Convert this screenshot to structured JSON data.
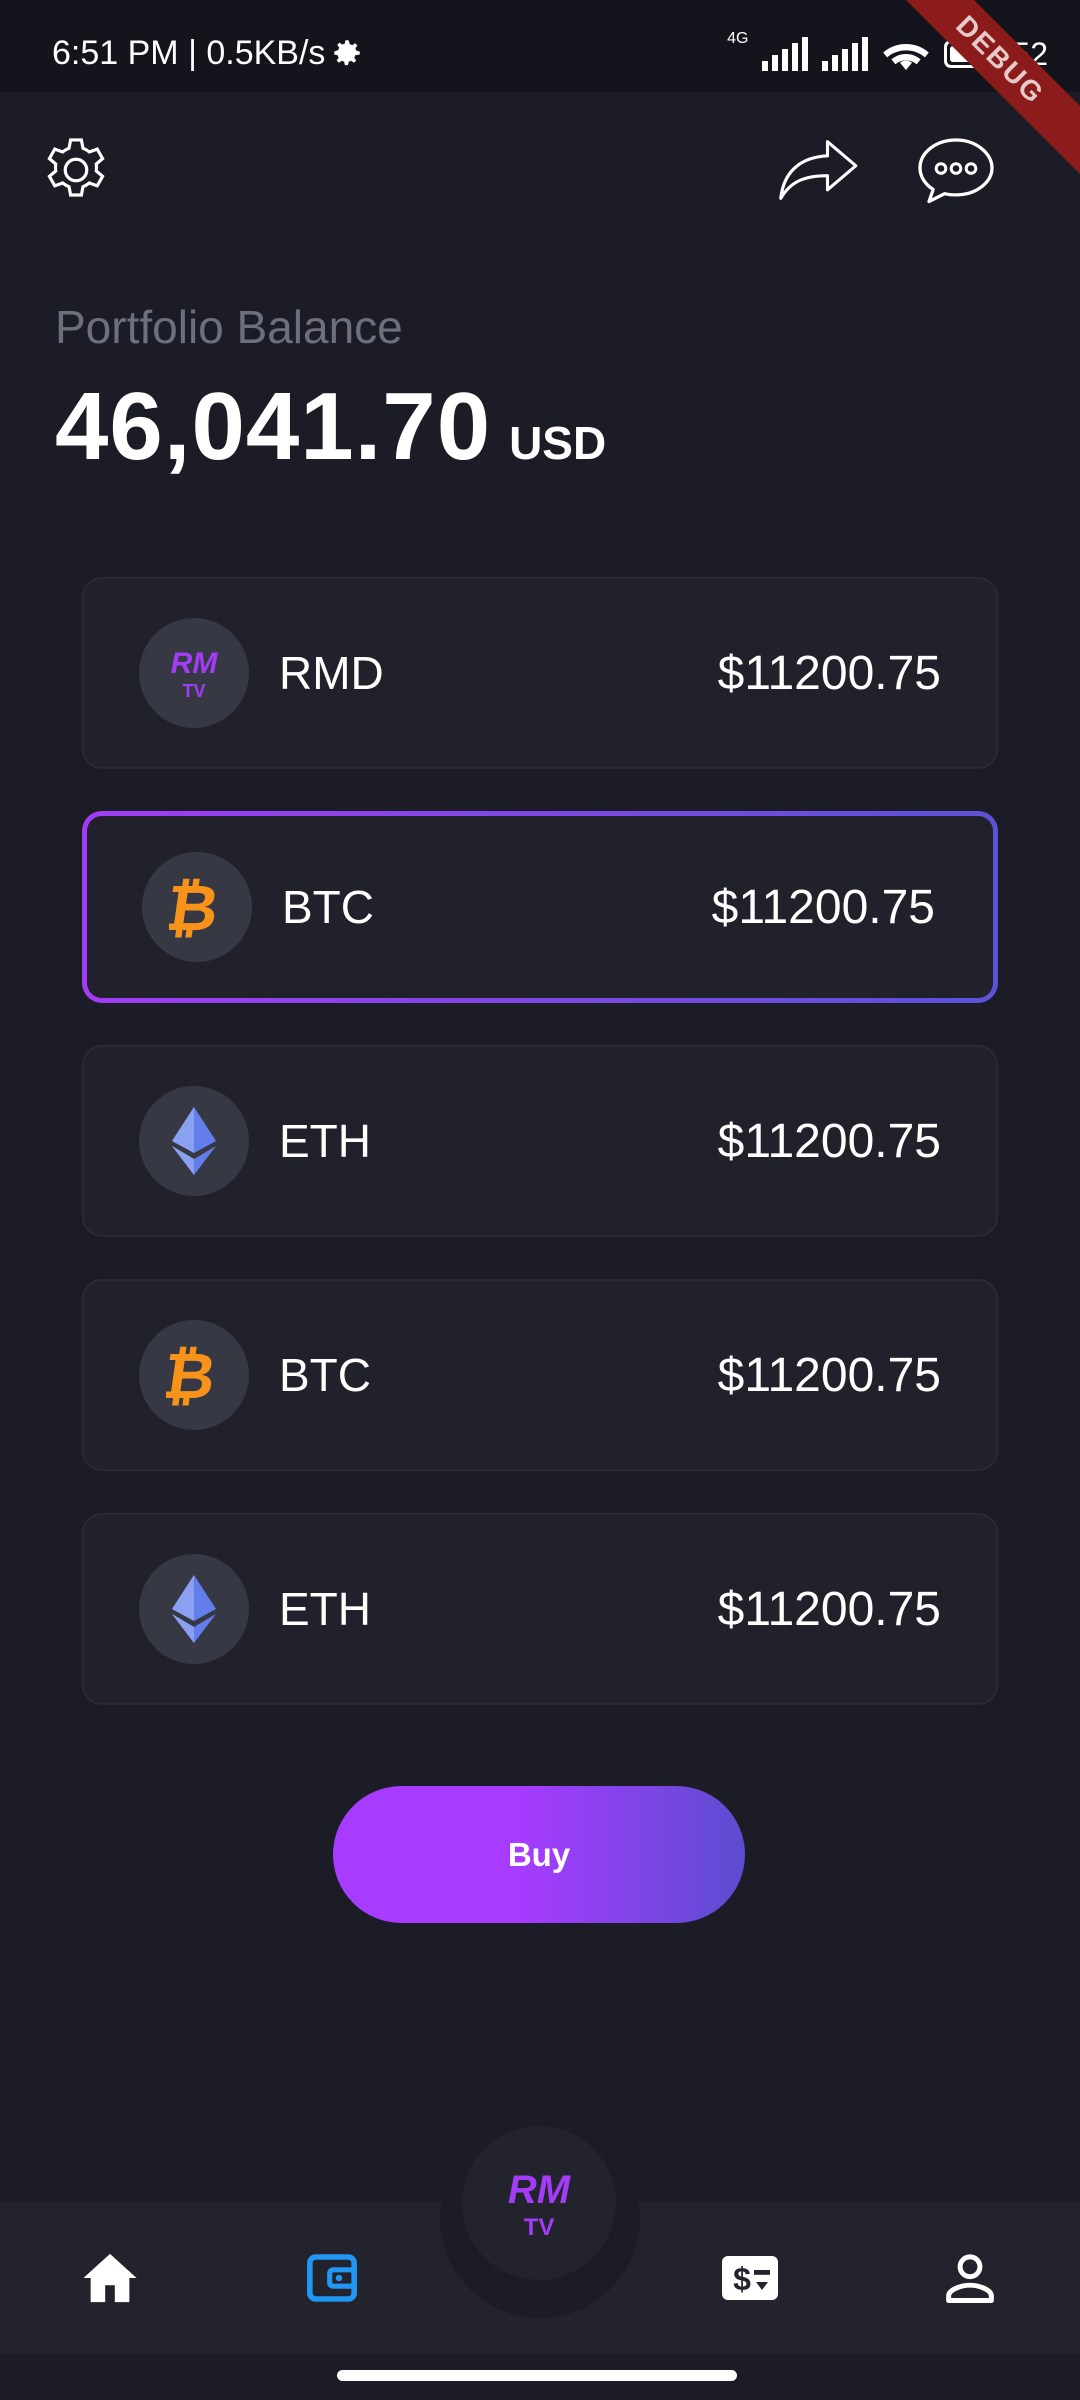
{
  "status_bar": {
    "time": "6:51 PM | 0.5KB/s",
    "network_label": "4G",
    "battery": "52",
    "debug_label": "DEBUG"
  },
  "header": {
    "icons": [
      "settings-icon",
      "share-icon",
      "chat-icon"
    ]
  },
  "portfolio": {
    "label": "Portfolio Balance",
    "amount": "46,041.70",
    "currency": "USD"
  },
  "assets": [
    {
      "symbol": "RMD",
      "value": "$11200.75",
      "icon": "rmtv-logo-icon",
      "selected": false
    },
    {
      "symbol": "BTC",
      "value": "$11200.75",
      "icon": "bitcoin-icon",
      "selected": true
    },
    {
      "symbol": "ETH",
      "value": "$11200.75",
      "icon": "ethereum-icon",
      "selected": false
    },
    {
      "symbol": "BTC",
      "value": "$11200.75",
      "icon": "bitcoin-icon",
      "selected": false
    },
    {
      "symbol": "ETH",
      "value": "$11200.75",
      "icon": "ethereum-icon",
      "selected": false
    }
  ],
  "actions": {
    "buy_label": "Buy"
  },
  "logo": {
    "top": "RM",
    "bottom": "TV"
  },
  "nav": {
    "items": [
      "home-icon",
      "wallet-icon",
      "rmtv-logo-icon",
      "exchange-icon",
      "profile-icon"
    ],
    "active": "wallet-icon"
  },
  "colors": {
    "background": "#1b1c26",
    "card": "#20212b",
    "accent_purple": "#a73bff",
    "accent_indigo": "#5c4cd0",
    "bitcoin_orange": "#f7931a",
    "ethereum_blue": "#627eea",
    "nav_active": "#2196f3"
  }
}
